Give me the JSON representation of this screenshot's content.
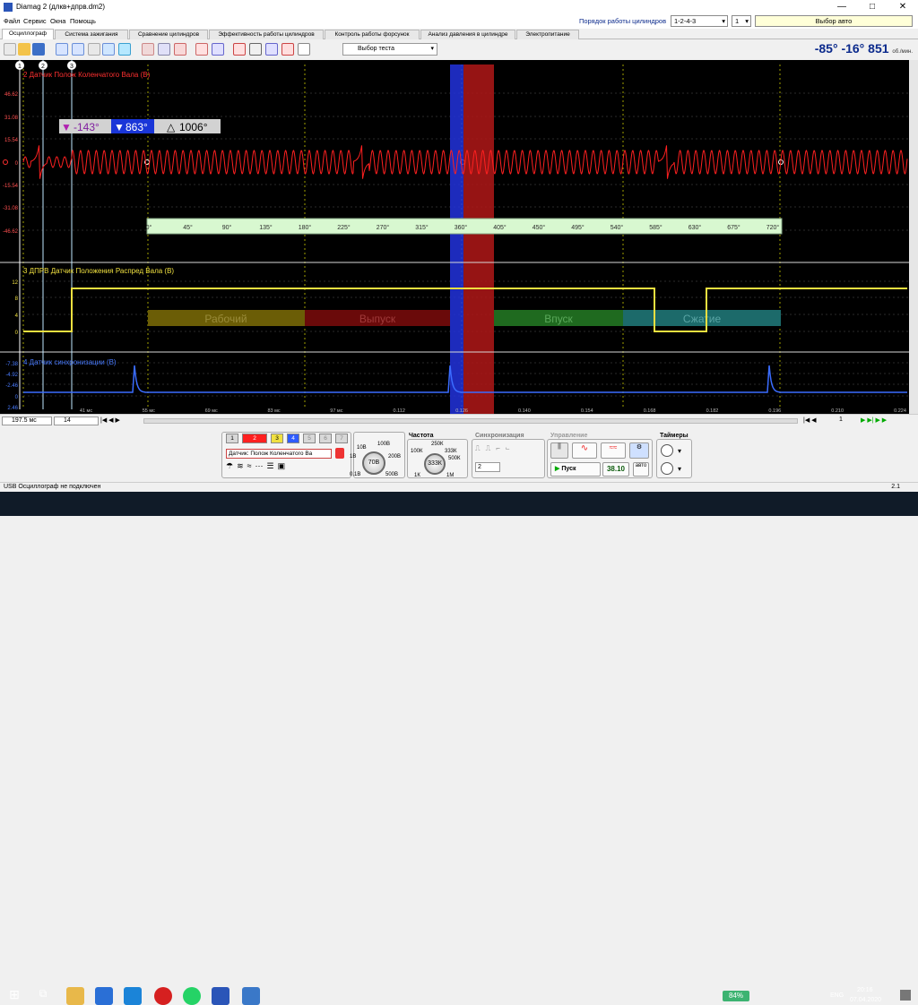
{
  "window": {
    "title": "Diamag 2 (длкв+дпрв.dm2)",
    "minimize_icon": "minimize-icon",
    "maximize_icon": "maximize-icon",
    "close_icon": "close-icon"
  },
  "menu": [
    "Файл",
    "Сервис",
    "Окна",
    "Помощь"
  ],
  "cylinder_order": {
    "label": "Порядок работы цилиндров",
    "value": "1-2-4-3",
    "cyl_value": "1",
    "auto_label": "Выбор авто"
  },
  "tabs": [
    "Осциллограф",
    "Система зажигания",
    "Сравнение цилиндров",
    "Эффективность работы цилиндров",
    "Контроль работы форсунок",
    "Анализ давления в цилиндре",
    "Электропитание"
  ],
  "toolbar": {
    "test_select": "Выбор теста"
  },
  "readout": {
    "text": "-85° -16° 851",
    "unit": "об./мин."
  },
  "markers": [
    "1",
    "2",
    "3"
  ],
  "ch2": {
    "title": "2 Датчик Полож Коленчатого Вала (В)",
    "yticks": [
      "46.62",
      "31.08",
      "15.54",
      "0",
      "-15.54",
      "-31.08",
      "-46.62"
    ],
    "cursors": {
      "a": "-143°",
      "b": "863°",
      "delta": "1006°"
    },
    "degrees": [
      "0°",
      "45°",
      "90°",
      "135°",
      "180°",
      "225°",
      "270°",
      "315°",
      "360°",
      "405°",
      "450°",
      "495°",
      "540°",
      "585°",
      "630°",
      "675°",
      "720°"
    ]
  },
  "ch3": {
    "title": "3 ДПРВ Датчик Положения Распред Вала (В)",
    "yticks": [
      "12",
      "8",
      "4",
      "0"
    ],
    "strokes": [
      "Рабочий",
      "Выпуск",
      "Впуск",
      "Сжатие"
    ]
  },
  "ch4": {
    "title": "4 Датчик синхронизации (В)",
    "yticks": [
      "-7.38",
      "-4.92",
      "-2.46",
      "0",
      "2.46"
    ]
  },
  "time_axis": [
    "41 мс",
    "55 мс",
    "69 мс",
    "83 мс",
    "97 мс",
    "0.112",
    "0.126",
    "0.140",
    "0.154",
    "0.168",
    "0.182",
    "0.196",
    "0.210",
    "0.224"
  ],
  "scroller": {
    "time_per_div": "197.5 мс",
    "channel": "14",
    "page": "1"
  },
  "panel": {
    "channels": [
      "1",
      "2",
      "3",
      "4",
      "5",
      "6",
      "7"
    ],
    "sensor": "Датчик: Полож Коленчатого Ва",
    "voltage_labels": [
      "10В",
      "100В",
      "1В",
      "200В",
      "0.1В",
      "500В"
    ],
    "voltage_value": "70В",
    "freq_title": "Частота",
    "freq_labels": [
      "250К",
      "100К",
      "333К",
      "500К",
      "1К",
      "1М"
    ],
    "freq_value": "333К",
    "sync_title": "Синхронизация",
    "sync_value": "2",
    "control_title": "Управление",
    "start_label": "Пуск",
    "rate_value": "38.10",
    "auto_label": "авто",
    "timers_title": "Таймеры"
  },
  "status": {
    "left": "USB Осциллограф не подключен",
    "right": "2.1"
  },
  "taskbar": {
    "battery": "84%",
    "lang": "ENG",
    "time": "20:16",
    "date": "07.04.2020"
  },
  "colors": {
    "ch2": "#ff2020",
    "ch3": "#f0e040",
    "ch4": "#3a6cff",
    "cursor_marker": "#ff3030"
  }
}
